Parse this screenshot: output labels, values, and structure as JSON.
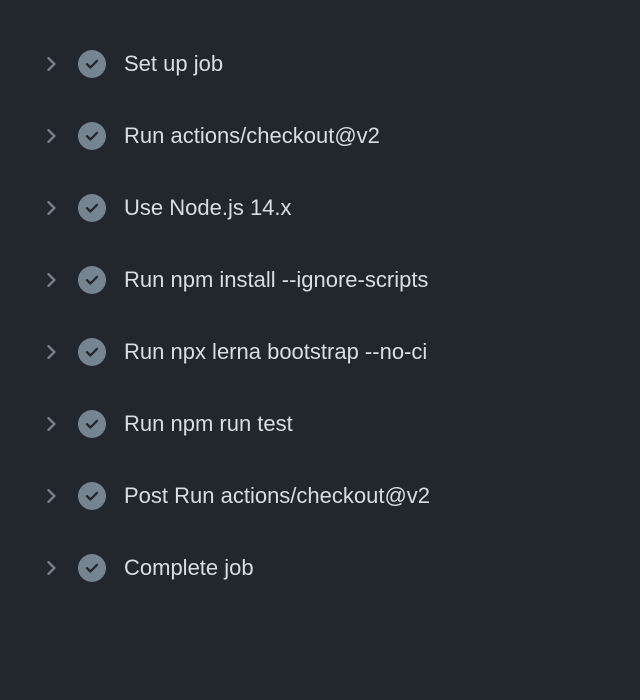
{
  "steps": [
    {
      "label": "Set up job",
      "status": "success"
    },
    {
      "label": "Run actions/checkout@v2",
      "status": "success"
    },
    {
      "label": "Use Node.js 14.x",
      "status": "success"
    },
    {
      "label": "Run npm install --ignore-scripts",
      "status": "success"
    },
    {
      "label": "Run npx lerna bootstrap --no-ci",
      "status": "success"
    },
    {
      "label": "Run npm run test",
      "status": "success"
    },
    {
      "label": "Post Run actions/checkout@v2",
      "status": "success"
    },
    {
      "label": "Complete job",
      "status": "success"
    }
  ],
  "colors": {
    "background": "#22272e",
    "text": "#d7dde3",
    "iconMuted": "#768390",
    "statusBg": "#768390",
    "checkStroke": "#22272e"
  }
}
